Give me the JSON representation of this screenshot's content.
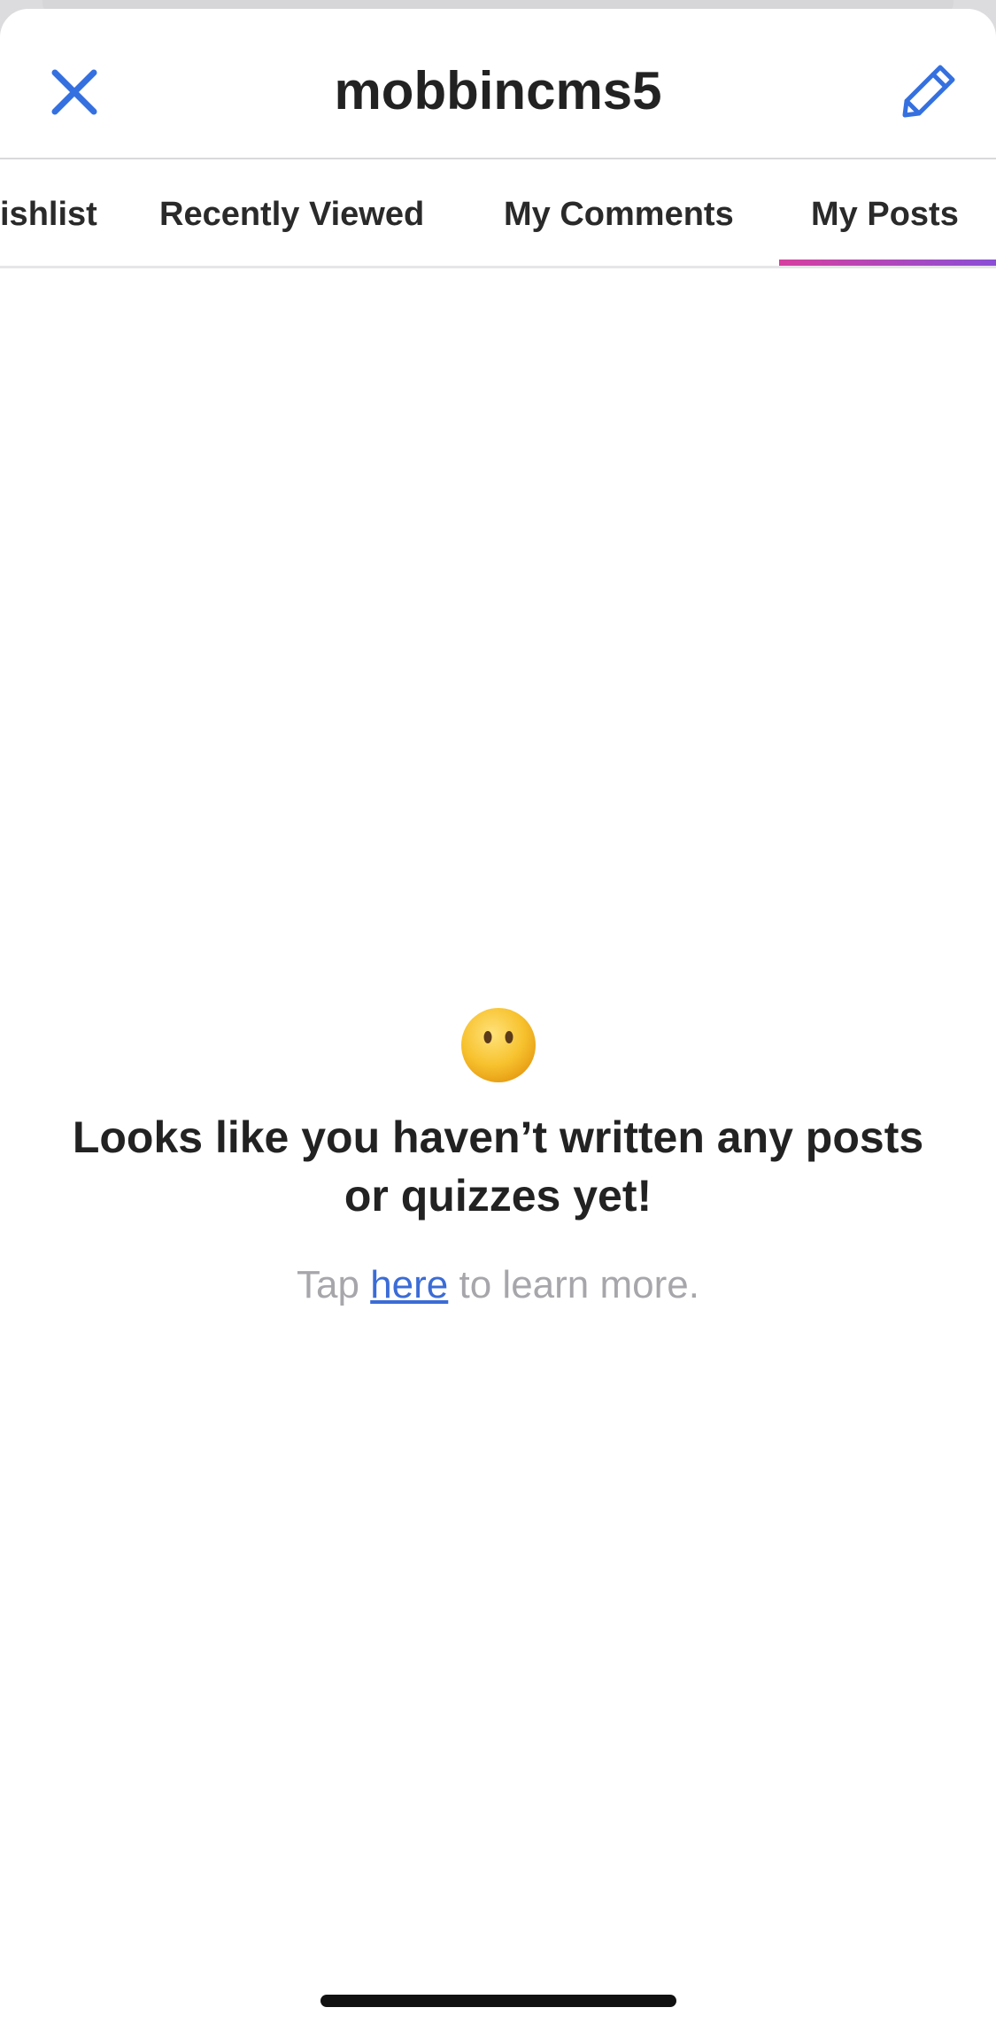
{
  "header": {
    "title": "mobbincms5",
    "close_icon": "close-icon",
    "edit_icon": "pencil-icon",
    "accent_color": "#3570e0"
  },
  "tabs": [
    {
      "label": "Wishlist",
      "visible_text": "ishlist",
      "active": false
    },
    {
      "label": "Recently Viewed",
      "active": false
    },
    {
      "label": "My Comments",
      "active": false
    },
    {
      "label": "My Posts",
      "active": true
    }
  ],
  "tab_indicator_colors": [
    "#d6409f",
    "#8a4fd6"
  ],
  "empty_state": {
    "emoji": "face-without-mouth",
    "message": "Looks like you haven’t written any posts or quizzes yet!",
    "sub_prefix": "Tap ",
    "sub_link": "here",
    "sub_suffix": " to learn more."
  }
}
